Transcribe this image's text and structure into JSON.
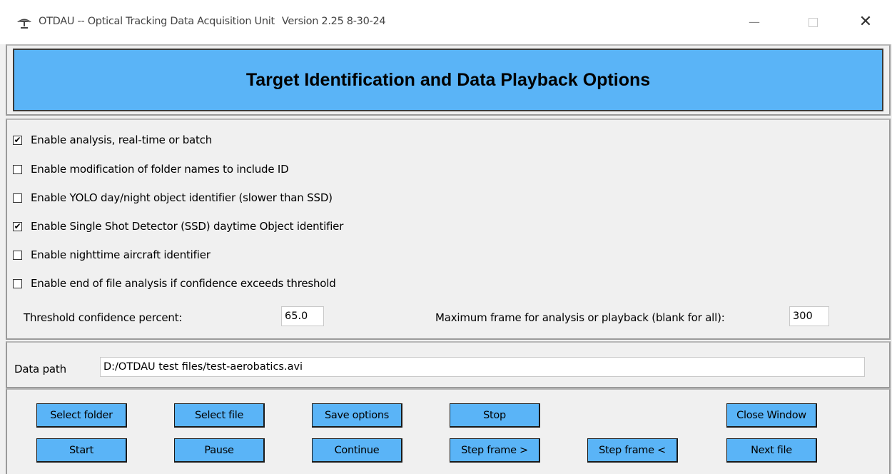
{
  "window": {
    "title": "OTDAU -- Optical Tracking Data Acquisition Unit",
    "version": "Version 2.25 8-30-24",
    "minimize_glyph": "—",
    "close_glyph": "✕"
  },
  "banner": {
    "title": "Target Identification and Data Playback Options"
  },
  "options": [
    {
      "label": "Enable analysis, real-time or batch",
      "checked": true,
      "mark": "✔"
    },
    {
      "label": "Enable modification of folder names to include ID",
      "checked": false,
      "mark": ""
    },
    {
      "label": "Enable YOLO day/night object identifier (slower than SSD)",
      "checked": false,
      "mark": ""
    },
    {
      "label": "Enable Single Shot Detector (SSD) daytime Object identifier",
      "checked": true,
      "mark": "✔"
    },
    {
      "label": "Enable nighttime aircraft identifier",
      "checked": false,
      "mark": ""
    },
    {
      "label": "Enable end of file analysis if confidence exceeds threshold",
      "checked": false,
      "mark": ""
    }
  ],
  "threshold": {
    "label": "Threshold confidence percent:",
    "value": "65.0"
  },
  "max_frame": {
    "label": "Maximum frame for analysis or playback (blank for all):",
    "value": "300"
  },
  "data_path": {
    "label": "Data path",
    "value": "D:/OTDAU test files/test-aerobatics.avi"
  },
  "buttons": {
    "select_folder": "Select folder",
    "select_file": "Select file",
    "save_options": "Save options",
    "stop": "Stop",
    "close_window": "Close Window",
    "start": "Start",
    "pause": "Pause",
    "continue": "Continue",
    "step_forward": "Step frame >",
    "step_back": "Step frame <",
    "next_file": "Next file"
  },
  "colors": {
    "accent": "#5ab4f7",
    "background": "#f0f0f0"
  },
  "icons": {
    "app": "tracking-dish-icon"
  }
}
